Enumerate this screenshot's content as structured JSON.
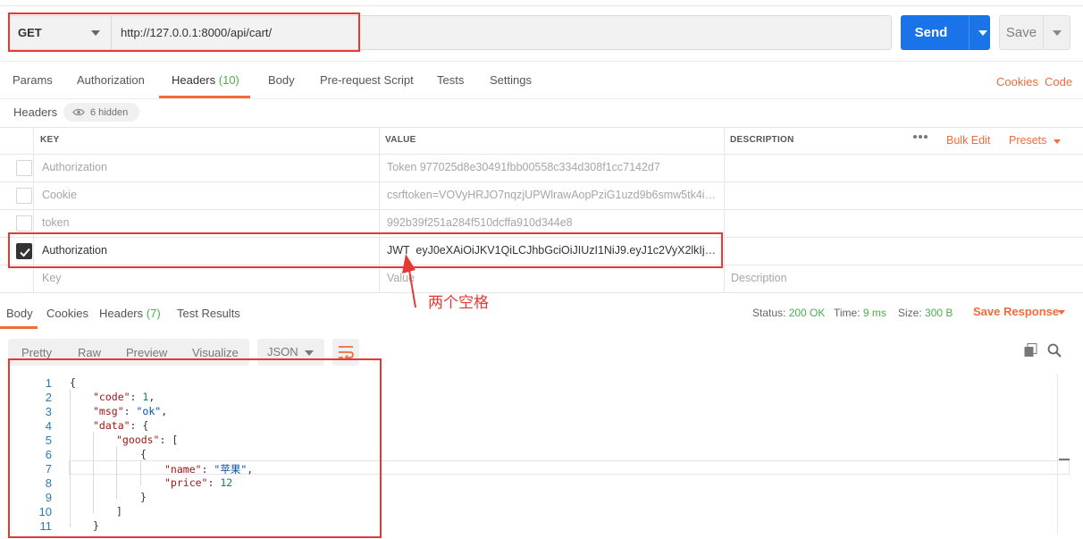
{
  "request": {
    "method": "GET",
    "url": "http://127.0.0.1:8000/api/cart/",
    "send_label": "Send",
    "save_label": "Save"
  },
  "request_tabs": [
    {
      "label": "Params"
    },
    {
      "label": "Authorization"
    },
    {
      "label": "Headers",
      "count": "(10)"
    },
    {
      "label": "Body"
    },
    {
      "label": "Pre-request Script"
    },
    {
      "label": "Tests"
    },
    {
      "label": "Settings"
    }
  ],
  "right_links": {
    "cookies": "Cookies",
    "code": "Code"
  },
  "headers_meta": {
    "label": "Headers",
    "hidden": "6 hidden"
  },
  "table": {
    "columns": {
      "key": "KEY",
      "value": "VALUE",
      "description": "DESCRIPTION"
    },
    "bulk_edit": "Bulk Edit",
    "presets": "Presets",
    "rows": [
      {
        "key": "Authorization",
        "value": "Token 977025d8e30491fbb00558c334d308f1cc7142d7",
        "checked": false
      },
      {
        "key": "Cookie",
        "value": "csrftoken=VOVyHRJO7nqzjUPWlrawAopPziG1uzd9b6smw5tk4in5…",
        "checked": false
      },
      {
        "key": "token",
        "value": "992b39f251a284f510dcffa910d344e8",
        "checked": false
      },
      {
        "key": "Authorization",
        "value": "JWT  eyJ0eXAiOiJKV1QiLCJhbGciOiJIUzI1NiJ9.eyJ1c2VyX2lkIjoxLCJ1c…",
        "checked": true
      }
    ],
    "placeholder": {
      "key": "Key",
      "value": "Value",
      "description": "Description"
    }
  },
  "annotation": "两个空格",
  "response": {
    "tabs": [
      {
        "label": "Body"
      },
      {
        "label": "Cookies"
      },
      {
        "label": "Headers",
        "count": "(7)"
      },
      {
        "label": "Test Results"
      }
    ],
    "status_label": "Status:",
    "status_value": "200 OK",
    "time_label": "Time:",
    "time_value": "9 ms",
    "size_label": "Size:",
    "size_value": "300 B",
    "save_response": "Save Response",
    "view_tabs": [
      "Pretty",
      "Raw",
      "Preview",
      "Visualize"
    ],
    "format": "JSON"
  },
  "code_lines": [
    "1",
    "2",
    "3",
    "4",
    "5",
    "6",
    "7",
    "8",
    "9",
    "10",
    "11"
  ],
  "json": {
    "k_code": "\"code\"",
    "v_code": "1",
    "k_msg": "\"msg\"",
    "v_msg": "\"ok\"",
    "k_data": "\"data\"",
    "k_goods": "\"goods\"",
    "k_name": "\"name\"",
    "v_name": "\"苹果\"",
    "k_price": "\"price\"",
    "v_price": "12"
  },
  "colors": {
    "accent": "#f26b3a",
    "primary": "#1a73e8",
    "success": "#4caf50",
    "annotation": "#e53935"
  }
}
